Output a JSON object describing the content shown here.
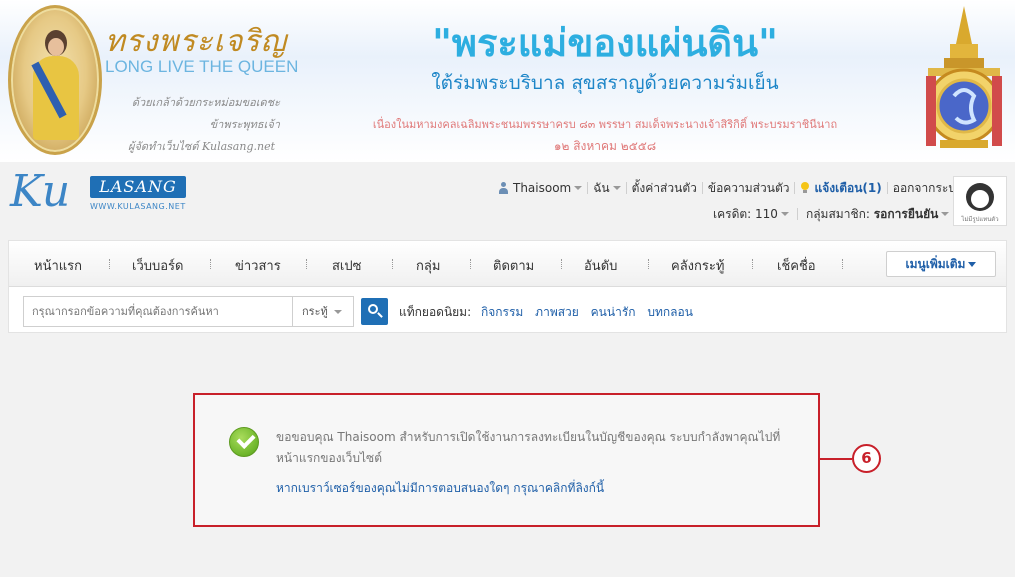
{
  "banner": {
    "queen_title": "ทรงพระเจริญ",
    "queen_subtitle": "LONG LIVE THE QUEEN",
    "queen_note_1": "ด้วยเกล้าด้วยกระหม่อมขอเดชะ",
    "queen_note_2": "ข้าพระพุทธเจ้า",
    "queen_note_3": "ผู้จัดทำเว็บไซต์ Kulasang.net",
    "motto": "\"พระแม่ของแผ่นดิน\"",
    "motto_sub": "ใต้ร่มพระบริบาล สุขสราญด้วยความร่มเย็น",
    "motto_note": "เนื่องในมหามงคลเฉลิมพระชนมพรรษาครบ ๘๓ พรรษา สมเด็จพระนางเจ้าสิริกิติ์ พระบรมราชินีนาถ",
    "motto_date": "๑๒ สิงหาคม ๒๕๕๘"
  },
  "logo": {
    "ku": "Ku",
    "box": "LASANG",
    "url": "WWW.KULASANG.NET"
  },
  "userbar": {
    "username": "Thaisoom",
    "me": "ฉัน",
    "settings": "ตั้งค่าส่วนตัว",
    "messages": "ข้อความส่วนตัว",
    "notify": "แจ้งเตือน(1)",
    "logout": "ออกจากระบบ"
  },
  "creditbar": {
    "credit_label": "เครดิต:",
    "credit_value": "110",
    "group_label": "กลุ่มสมาชิก:",
    "group_value": "รอการยืนยัน"
  },
  "avatar": {
    "label": "ไม่มีรูปแทนตัว"
  },
  "nav": {
    "items": [
      "หน้าแรก",
      "เว็บบอร์ด",
      "ข่าวสาร",
      "สเปซ",
      "กลุ่ม",
      "ติดตาม",
      "อันดับ",
      "คลังกระทู้",
      "เช็คชื่อ"
    ],
    "more": "เมนูเพิ่มเติม"
  },
  "search": {
    "placeholder": "กรุณากรอกข้อความที่คุณต้องการค้นหา",
    "scope": "กระทู้",
    "hot_label": "แท็กยอดนิยม:",
    "hot_tags": [
      "กิจกรรม",
      "ภาพสวย",
      "คนน่ารัก",
      "บทกลอน"
    ]
  },
  "message": {
    "text": "ขอขอบคุณ Thaisoom สำหรับการเปิดใช้งานการลงทะเบียนในบัญชีของคุณ ระบบกำลังพาคุณไปที่หน้าแรกของเว็บไซต์",
    "link": "หากเบราว์เซอร์ของคุณไม่มีการตอบสนองใดๆ กรุณาคลิกที่ลิงก์นี้"
  },
  "callout": {
    "number": "6"
  },
  "colors": {
    "accent": "#1f6fb5",
    "link": "#1f5fa8",
    "highlight": "#c8202a"
  }
}
